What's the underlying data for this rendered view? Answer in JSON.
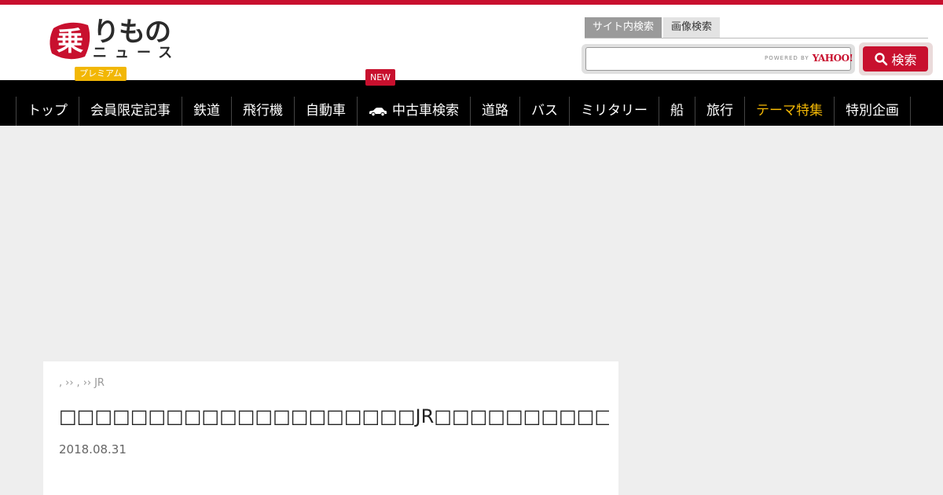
{
  "brand": {
    "logo_kanji": "乗",
    "logo_top": "りもの",
    "logo_bottom": "ニュース",
    "premium_tag": "プレミアム",
    "accent_color": "#c8102e",
    "premium_color": "#f2b705"
  },
  "search": {
    "tabs": [
      {
        "label": "サイト内検索",
        "active": true
      },
      {
        "label": "画像検索",
        "active": false
      }
    ],
    "input_value": "",
    "powered_by": "POWERED BY",
    "powered_brand": "YAHOO!",
    "button_label": "検索",
    "button_icon": "search-icon"
  },
  "nav": {
    "new_badge": "NEW",
    "items": [
      {
        "label": "トップ"
      },
      {
        "label": "会員限定記事"
      },
      {
        "label": "鉄道"
      },
      {
        "label": "飛行機"
      },
      {
        "label": "自動車"
      },
      {
        "label": "中古車検索",
        "icon": "car-icon"
      },
      {
        "label": "道路"
      },
      {
        "label": "バス"
      },
      {
        "label": "ミリタリー"
      },
      {
        "label": "船"
      },
      {
        "label": "旅行"
      },
      {
        "label": "テーマ特集",
        "highlight_color": "#f2b705"
      },
      {
        "label": "特別企画"
      }
    ]
  },
  "article": {
    "breadcrumb": [
      ",",
      "››",
      ",",
      "››",
      "JR"
    ],
    "title": "□□□□□□□□□□□□□□□□□□□□JR□□□□□□□□□□□□□□□□□□□□□□□",
    "date": "2018.08.31"
  }
}
